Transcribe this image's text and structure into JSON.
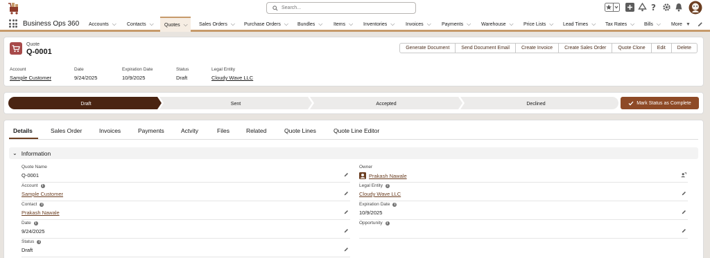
{
  "search": {
    "placeholder": "Search..."
  },
  "app": {
    "name": "Business Ops 360"
  },
  "nav": {
    "items": [
      {
        "label": "Accounts"
      },
      {
        "label": "Contacts"
      },
      {
        "label": "Quotes"
      },
      {
        "label": "Sales Orders"
      },
      {
        "label": "Purchase Orders"
      },
      {
        "label": "Bundles"
      },
      {
        "label": "Items"
      },
      {
        "label": "Inventories"
      },
      {
        "label": "Invoices"
      },
      {
        "label": "Payments"
      },
      {
        "label": "Warehouse"
      },
      {
        "label": "Price Lists"
      },
      {
        "label": "Lead Times"
      },
      {
        "label": "Tax Rates"
      },
      {
        "label": "Bills"
      }
    ],
    "more_label": "More",
    "active_index": 2
  },
  "record": {
    "type": "Quote",
    "name": "Q-0001",
    "actions": [
      "Generate Document",
      "Send Document Email",
      "Create Invoice",
      "Create Sales Order",
      "Quote Clone",
      "Edit",
      "Delete"
    ],
    "highlights": [
      {
        "label": "Account",
        "value": "Sample Customer",
        "link": true
      },
      {
        "label": "Date",
        "value": "9/24/2025",
        "link": false
      },
      {
        "label": "Expiration Date",
        "value": "10/9/2025",
        "link": false
      },
      {
        "label": "Status",
        "value": "Draft",
        "link": false
      },
      {
        "label": "Legal Entity",
        "value": "Cloudy Wave LLC",
        "link": true
      }
    ]
  },
  "path": {
    "stages": [
      "Draft",
      "Sent",
      "Accepted",
      "Declined"
    ],
    "current": 0,
    "mark_complete_label": "Mark Status as Complete"
  },
  "tabs": [
    "Details",
    "Sales Order",
    "Invoices",
    "Payments",
    "Actvity",
    "Files",
    "Related",
    "Quote Lines",
    "Quote Line Editor"
  ],
  "section": {
    "title": "Information"
  },
  "fields_left": [
    {
      "label": "Quote Name",
      "value": "Q-0001",
      "info": false,
      "link": false
    },
    {
      "label": "Account",
      "value": "Sample Customer",
      "info": true,
      "link": true
    },
    {
      "label": "Contact",
      "value": "Prakash Nawale",
      "info": true,
      "link": true
    },
    {
      "label": "Date",
      "value": "9/24/2025",
      "info": true,
      "link": false
    },
    {
      "label": "Status",
      "value": "Draft",
      "info": true,
      "link": false
    }
  ],
  "fields_right": [
    {
      "label": "Owner",
      "value": "Prakash Nawale",
      "info": false,
      "link": true
    },
    {
      "label": "Legal Entity",
      "value": "Cloudy Wave LLC",
      "info": true,
      "link": true
    },
    {
      "label": "Expiration Date",
      "value": "10/9/2025",
      "info": true,
      "link": false
    },
    {
      "label": "Opportunity",
      "value": "",
      "info": true,
      "link": false
    }
  ],
  "colors": {
    "accent": "#6b3e21",
    "path_active": "#4a2412",
    "button": "#8e4a26",
    "nav_accent": "#c69a6a"
  }
}
